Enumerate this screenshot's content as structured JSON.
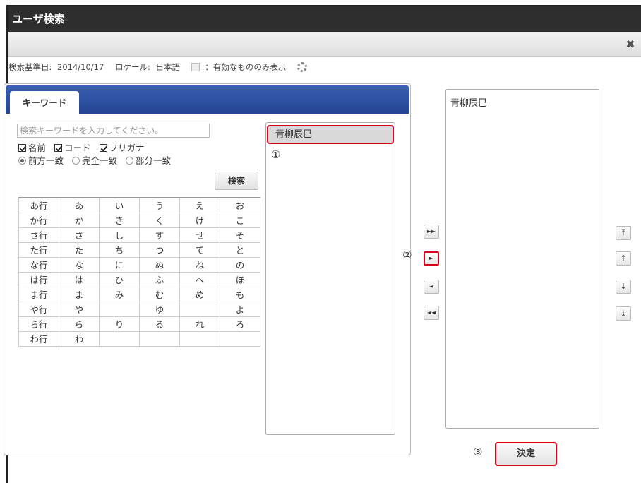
{
  "window": {
    "title": "ユーザ検索",
    "close_icon": "✖"
  },
  "info": {
    "base_date_label": "検索基準日:",
    "base_date_value": "2014/10/17",
    "locale_label": "ロケール:",
    "locale_value": "日本語",
    "valid_only_label": "：有効なもののみ表示",
    "settings_icon": "gear-icon"
  },
  "search": {
    "tab_label": "キーワード",
    "placeholder": "検索キーワードを入力してください。",
    "target_options": [
      "名前",
      "コード",
      "フリガナ"
    ],
    "match_options": [
      "前方一致",
      "完全一致",
      "部分一致"
    ],
    "selected_match": "前方一致",
    "search_button": "検索",
    "kana_rows": [
      [
        "あ行",
        "あ",
        "い",
        "う",
        "え",
        "お"
      ],
      [
        "か行",
        "か",
        "き",
        "く",
        "け",
        "こ"
      ],
      [
        "さ行",
        "さ",
        "し",
        "す",
        "せ",
        "そ"
      ],
      [
        "た行",
        "た",
        "ち",
        "つ",
        "て",
        "と"
      ],
      [
        "な行",
        "な",
        "に",
        "ぬ",
        "ね",
        "の"
      ],
      [
        "は行",
        "は",
        "ひ",
        "ふ",
        "へ",
        "ほ"
      ],
      [
        "ま行",
        "ま",
        "み",
        "む",
        "め",
        "も"
      ],
      [
        "や行",
        "や",
        "",
        "ゆ",
        "",
        "よ"
      ],
      [
        "ら行",
        "ら",
        "り",
        "る",
        "れ",
        "ろ"
      ],
      [
        "わ行",
        "わ",
        "",
        "",
        "",
        ""
      ]
    ]
  },
  "results": {
    "items": [
      "青柳辰巳"
    ],
    "marker": "①"
  },
  "move": {
    "add_all_icon": "►►",
    "add_icon": "►",
    "remove_icon": "◄",
    "remove_all_icon": "◄◄",
    "marker": "②"
  },
  "selected": {
    "items": [
      "青柳辰巳"
    ]
  },
  "order": {
    "top_icon": "⤒",
    "up_icon": "↑",
    "down_icon": "↓",
    "bottom_icon": "⤓"
  },
  "confirm": {
    "label": "決定",
    "marker": "③"
  }
}
